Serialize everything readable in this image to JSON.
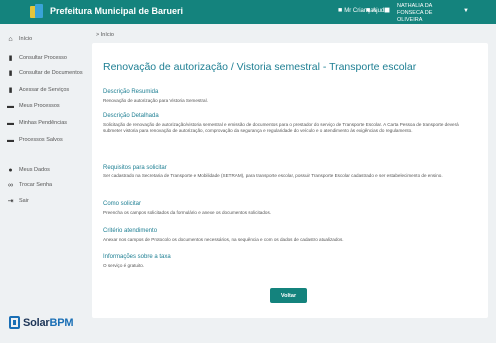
{
  "header": {
    "app_title": "Prefeitura Municipal de Barueri",
    "actions": [
      {
        "label": "Mr Crianças",
        "icon": "bell-icon"
      },
      {
        "label": "Ajuda",
        "icon": "help-icon"
      }
    ],
    "user_name": "NATHALIA DA FONSECA DE OLIVEIRA"
  },
  "sidebar": {
    "items": [
      {
        "label": "Início",
        "icon": "home-icon"
      },
      {
        "label": "Consultar Processo",
        "icon": "document-icon"
      },
      {
        "label": "Consultar de Documentos",
        "icon": "document-icon"
      },
      {
        "label": "Acessar de Serviços",
        "icon": "document-icon"
      },
      {
        "label": "Meus Processos",
        "icon": "folder-icon"
      },
      {
        "label": "Minhas Pendências",
        "icon": "folder-icon"
      },
      {
        "label": "Processos Salvos",
        "icon": "folder-icon"
      },
      {
        "label": "Meus Dados",
        "icon": "user-icon"
      },
      {
        "label": "Trocar Senha",
        "icon": "key-icon"
      },
      {
        "label": "Sair",
        "icon": "logout-icon"
      }
    ]
  },
  "brand": {
    "part1": "Solar",
    "part2": "BPM"
  },
  "breadcrumb": "> Início",
  "main": {
    "title": "Renovação de autorização / Vistoria semestral - Transporte escolar",
    "sections": [
      {
        "heading": "Descrição Resumida",
        "text": "Renovação de autorização para Vistoria Semestral."
      },
      {
        "heading": "Descrição Detalhada",
        "text": "Solicitação de renovação de autorização/vistoria semestral e emissão de documentos para o prestador do serviço de Transporte Escolar. A Carta Pessoa de transporte deverá submeter vistoria para renovação de autorização, comprovação da segurança e regularidade do veículo e o atendimento às exigências do regulamento."
      },
      {
        "heading": "Requisitos para solicitar",
        "text": "Ser cadastrado na Secretaria de Transporte e Mobilidade (SETRAM), para transporte escolar, possuir Transporte Escolar cadastrado e ser estabelecimento de ensino."
      },
      {
        "heading": "Como solicitar",
        "text": "Preencha os campos solicitados da formulário e anexe os documentos solicitados."
      },
      {
        "heading": "Critério atendimento",
        "text": "Anexar nos campos de Protocolo os documentos necessários, na sequência e com os dados de cadastro atualizados."
      },
      {
        "heading": "Informações sobre a taxa",
        "text": "O serviço é gratuito."
      }
    ],
    "back_label": "Voltar"
  }
}
